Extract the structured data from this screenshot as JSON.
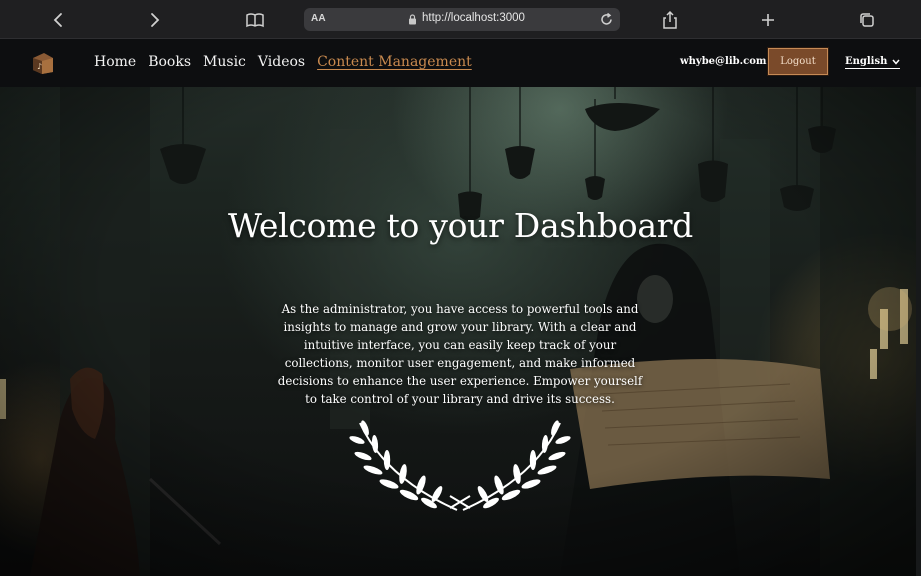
{
  "browser": {
    "address_prefix": "AA",
    "url": "http://localhost:3000"
  },
  "nav": {
    "links": [
      {
        "label": "Home"
      },
      {
        "label": "Books"
      },
      {
        "label": "Music"
      },
      {
        "label": "Videos"
      },
      {
        "label": "Content Management",
        "active": true
      }
    ],
    "user_email": "whybe@lib.com",
    "logout_label": "Logout",
    "language": "English"
  },
  "hero": {
    "title": "Welcome to your Dashboard",
    "description": "As the administrator, you have access to powerful tools and insights to manage and grow your library. With a clear and intuitive interface, you can easily keep track of your collections, monitor user engagement, and make informed decisions to enhance the user experience. Empower yourself to take control of your library and drive its success."
  },
  "colors": {
    "nav_bg": "#0d0e10",
    "active_link": "#c98a4f",
    "logout_bg": "#7a4a2a",
    "browser_bar": "#1f1f21"
  },
  "icons": [
    "back-icon",
    "forward-icon",
    "bookmarks-icon",
    "lock-icon",
    "reload-icon",
    "share-icon",
    "new-tab-icon",
    "tabs-icon",
    "logo-icon",
    "chevron-down-icon",
    "laurel-icon"
  ]
}
